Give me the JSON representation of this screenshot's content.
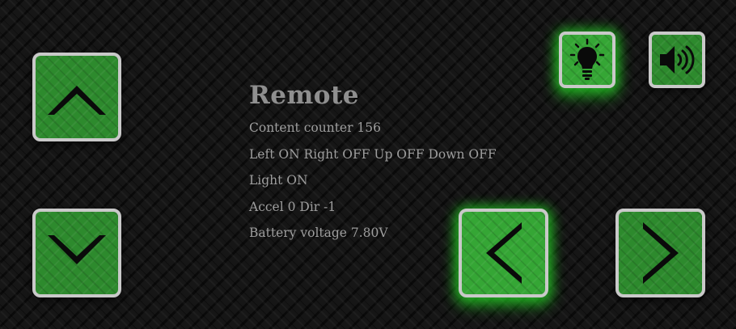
{
  "title": "Remote",
  "status": {
    "content_counter": "Content counter 156",
    "directions": "Left ON Right OFF Up OFF Down OFF",
    "light": "Light ON",
    "accel": "Accel 0 Dir -1",
    "battery": "Battery voltage 7.80V"
  },
  "controls": {
    "up": {
      "icon": "chevron-up-icon",
      "state": "off"
    },
    "down": {
      "icon": "chevron-down-icon",
      "state": "off"
    },
    "left": {
      "icon": "chevron-left-icon",
      "state": "on"
    },
    "right": {
      "icon": "chevron-right-icon",
      "state": "off"
    },
    "light": {
      "icon": "lightbulb-icon",
      "state": "on"
    },
    "sound": {
      "icon": "speaker-icon",
      "state": "off"
    }
  },
  "colors": {
    "button_green": "#2d8a2d",
    "button_active_green": "#35a635",
    "glow": "#28e628",
    "border": "#c9c9c9",
    "text": "#9e9e9e"
  }
}
